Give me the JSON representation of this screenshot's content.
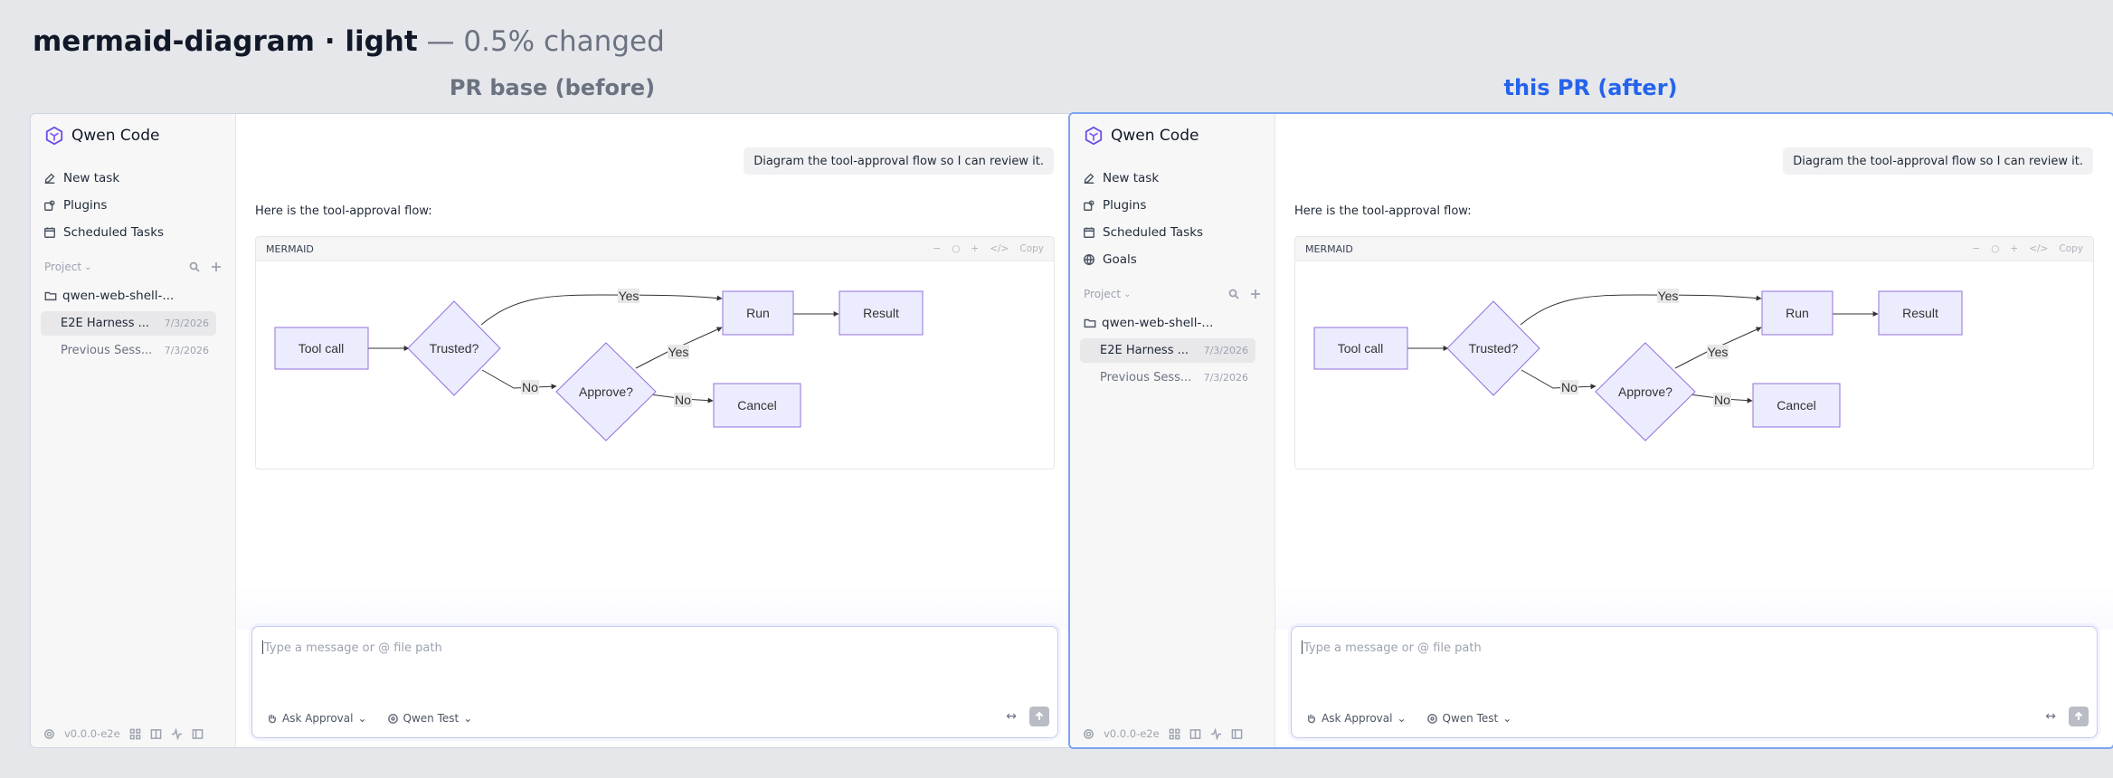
{
  "header": {
    "title": "mermaid-diagram · light",
    "separator": "—",
    "subtitle": "0.5% changed"
  },
  "columns": {
    "before_label": "PR base (before)",
    "after_label": "this PR (after)"
  },
  "app": {
    "name": "Qwen Code",
    "nav": {
      "new_task": "New task",
      "plugins": "Plugins",
      "scheduled": "Scheduled Tasks",
      "goals": "Goals"
    },
    "project_label": "Project",
    "folder": "qwen-web-shell-...",
    "sessions": [
      {
        "title": "E2E Harness ...",
        "date": "7/3/2026"
      },
      {
        "title": "Previous Sess...",
        "date": "7/3/2026"
      }
    ],
    "version": "v0.0.0-e2e"
  },
  "chat": {
    "user_message": "Diagram the tool-approval flow so I can review it.",
    "assistant_text": "Here is the tool-approval flow:",
    "code_block_label": "MERMAID",
    "code_tools": [
      "−",
      "○",
      "+",
      "</>",
      "Copy"
    ],
    "composer_placeholder": "Type a message or @ file path",
    "mode_label": "Ask Approval",
    "model_label": "Qwen Test"
  },
  "diagram": {
    "nodes": {
      "tool_call": "Tool call",
      "trusted": "Trusted?",
      "approve": "Approve?",
      "run": "Run",
      "result": "Result",
      "cancel": "Cancel"
    },
    "edge_labels": {
      "trusted_yes": "Yes",
      "trusted_no": "No",
      "approve_yes": "Yes",
      "approve_no": "No"
    }
  },
  "colors": {
    "node_fill": "#ececff",
    "node_stroke": "#9370db",
    "accent_after": "#2563eb"
  }
}
